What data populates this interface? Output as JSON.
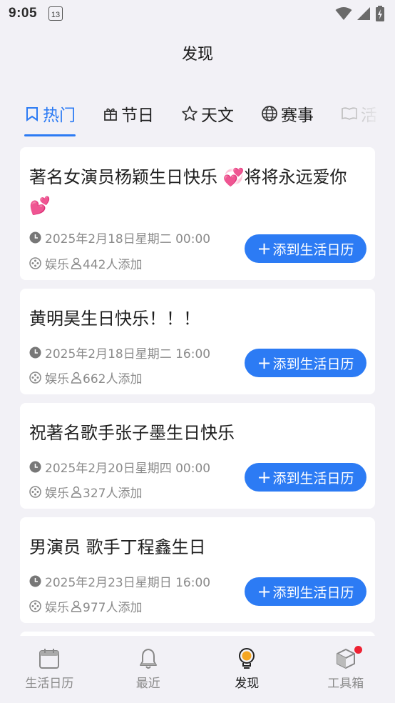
{
  "status_bar": {
    "time": "9:05",
    "calendar_day": "13"
  },
  "header": {
    "title": "发现"
  },
  "tabs": [
    {
      "label": "热门",
      "icon": "bookmark-icon",
      "active": true
    },
    {
      "label": "节日",
      "icon": "gift-icon",
      "active": false
    },
    {
      "label": "天文",
      "icon": "star-icon",
      "active": false
    },
    {
      "label": "赛事",
      "icon": "globe-icon",
      "active": false
    },
    {
      "label": "活",
      "icon": "book-icon",
      "active": false
    }
  ],
  "cards": [
    {
      "title": "著名女演员杨颖生日快乐 💞将将永远爱你 💕",
      "datetime": "2025年2月18日星期二 00:00",
      "category": "娱乐",
      "added": "442人添加",
      "button": "添到生活日历"
    },
    {
      "title": "黄明昊生日快乐！！！",
      "datetime": "2025年2月18日星期二 16:00",
      "category": "娱乐",
      "added": "662人添加",
      "button": "添到生活日历"
    },
    {
      "title": "祝著名歌手张子墨生日快乐",
      "datetime": "2025年2月20日星期四 00:00",
      "category": "娱乐",
      "added": "327人添加",
      "button": "添到生活日历"
    },
    {
      "title": "男演员 歌手丁程鑫生日",
      "datetime": "2025年2月23日星期日 16:00",
      "category": "娱乐",
      "added": "977人添加",
      "button": "添到生活日历"
    }
  ],
  "bottom_nav": [
    {
      "label": "生活日历",
      "icon": "calendar-icon",
      "active": false
    },
    {
      "label": "最近",
      "icon": "bell-icon",
      "active": false
    },
    {
      "label": "发现",
      "icon": "lightbulb-icon",
      "active": true
    },
    {
      "label": "工具箱",
      "icon": "box-icon",
      "active": false,
      "badge": true
    }
  ],
  "colors": {
    "accent": "#2c7bf4",
    "badge": "#ee2233",
    "background": "#f2f1f6"
  }
}
